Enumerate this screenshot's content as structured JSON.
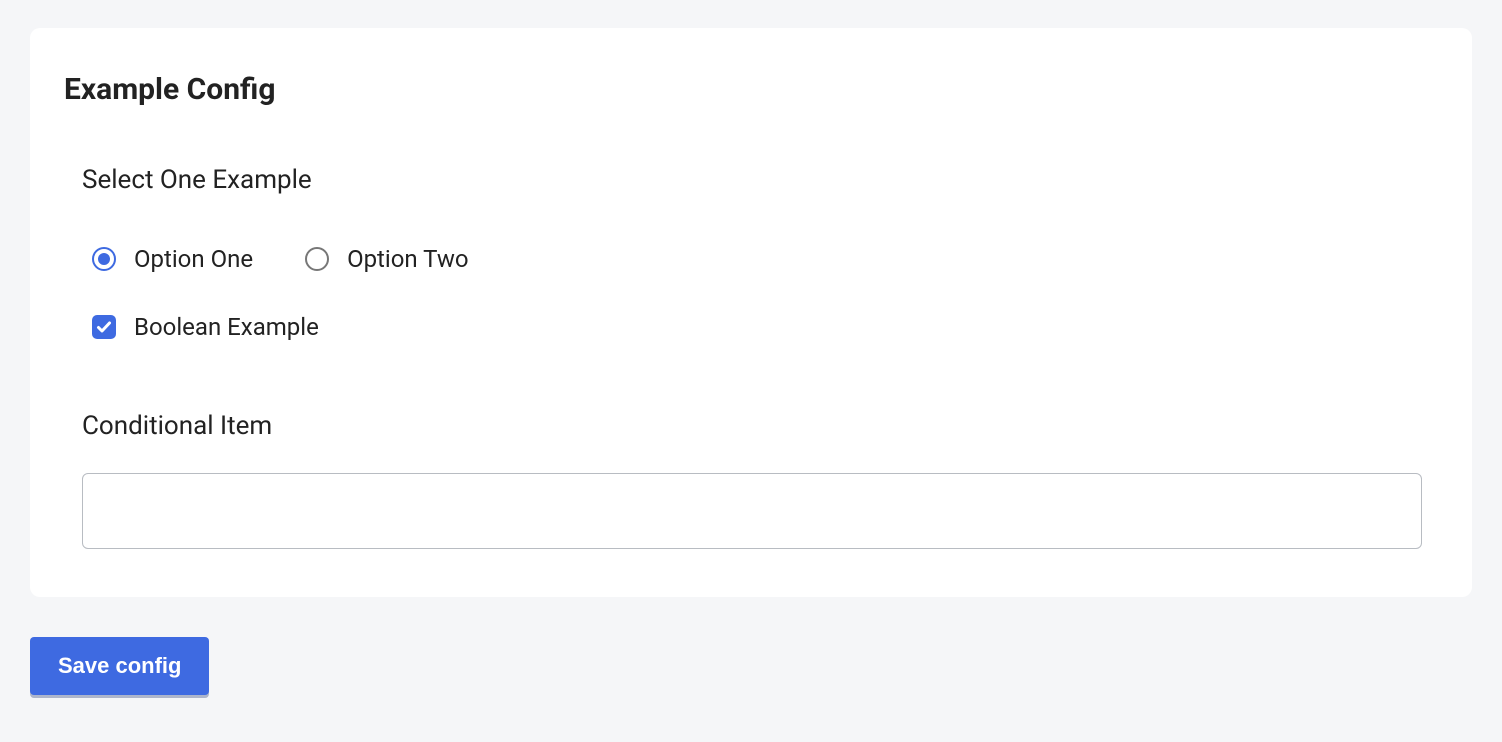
{
  "card": {
    "title": "Example Config"
  },
  "radio_group": {
    "label": "Select One Example",
    "options": [
      {
        "label": "Option One",
        "selected": true
      },
      {
        "label": "Option Two",
        "selected": false
      }
    ]
  },
  "checkbox": {
    "label": "Boolean Example",
    "checked": true
  },
  "text_field": {
    "label": "Conditional Item",
    "value": ""
  },
  "buttons": {
    "save": "Save config"
  }
}
